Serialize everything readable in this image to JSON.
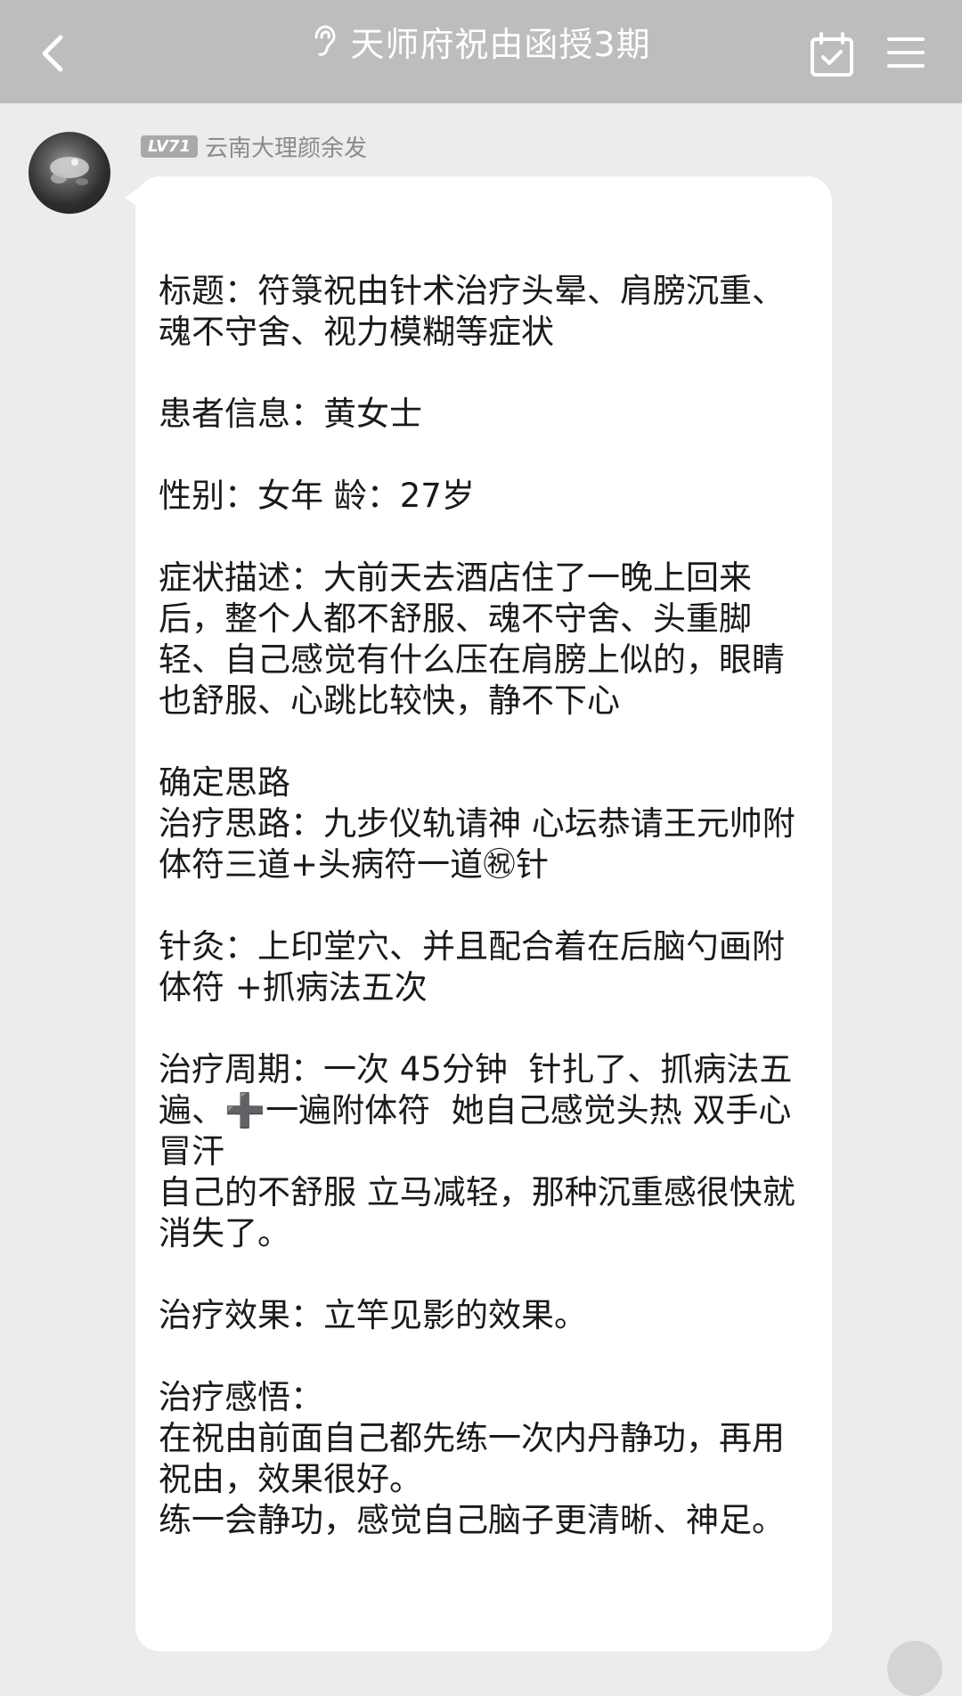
{
  "header": {
    "title": "天师府祝由函授3期",
    "back_icon": "chevron-left-icon",
    "ear_icon": "ear-icon",
    "calendar_icon": "calendar-check-icon",
    "menu_icon": "menu-icon"
  },
  "message": {
    "level": "LV71",
    "sender": "云南大理颜余发",
    "lines": [
      "标题：符箓祝由针术治疗头晕、肩膀沉重、魂不守舍、视力模糊等症状",
      "",
      "患者信息：黄女士",
      "",
      "性别：女年 龄：27岁",
      "",
      "症状描述：大前天去酒店住了一晚上回来后，整个人都不舒服、魂不守舍、头重脚轻、自己感觉有什么压在肩膀上似的，眼睛也舒服、心跳比较快，静不下心",
      "",
      "确定思路",
      "治疗思路：九步仪轨请神 心坛恭请王元帅附体符三道+头病符一道㊗针",
      "",
      "针灸：上印堂穴、并且配合着在后脑勺画附体符 +抓病法五次",
      "",
      "治疗周期：一次 45分钟  针扎了、抓病法五遍、➕一遍附体符  她自己感觉头热 双手心冒汗",
      "自己的不舒服 立马减轻，那种沉重感很快就消失了。",
      "",
      "治疗效果：立竿见影的效果。",
      "",
      "治疗感悟：",
      "在祝由前面自己都先练一次内丹静功，再用祝由，效果很好。",
      "练一会静功，感觉自己脑子更清晰、神足。"
    ]
  }
}
